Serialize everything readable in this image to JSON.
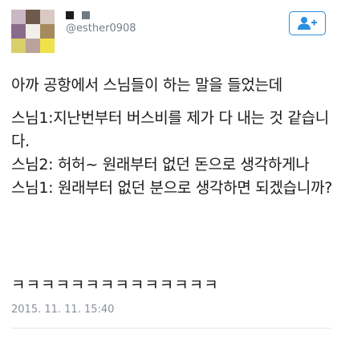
{
  "profile": {
    "handle": "@esther0908",
    "avatar_colors": [
      "#c9b7c4",
      "#6e5a4a",
      "#d9c9c2",
      "#8a6b8c",
      "#f2eee9",
      "#a48a5c",
      "#d8cf6a",
      "#b9a39c",
      "#f0e24a"
    ],
    "handle_mosaic_colors": [
      "#1c1c1c",
      "#ffffff",
      "#6f7a84"
    ],
    "follow_icon": "add-user-icon",
    "accent_color": "#2c8ee0"
  },
  "tweet": {
    "lines": [
      "아까 공항에서 스님들이 하는 말을 들었는데",
      "스님1:지난번부터 버스비를 제가 다 내는 것 같습니다.",
      "스님2: 허허~ 원래부터 없던 돈으로 생각하게나",
      "스님1: 원래부터 없던 분으로 생각하면 되겠습니까?"
    ],
    "laugh": "ㅋㅋㅋㅋㅋㅋㅋㅋㅋㅋㅋㅋㅋㅋ"
  },
  "meta": {
    "timestamp": "2015. 11. 11. 15:40"
  }
}
